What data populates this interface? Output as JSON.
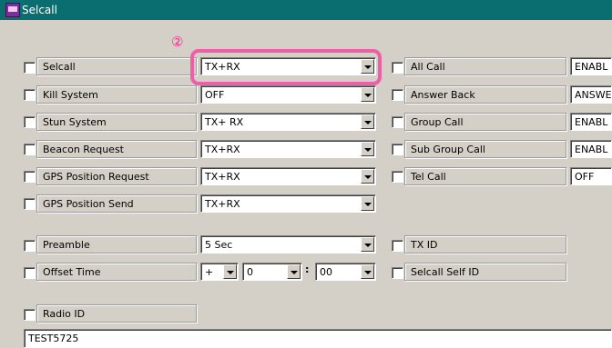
{
  "window": {
    "title": "Selcall",
    "annotation_marker": "②"
  },
  "rows": {
    "selcall": {
      "label": "Selcall",
      "value": "TX+RX"
    },
    "kill_system": {
      "label": "Kill System",
      "value": "OFF"
    },
    "stun_system": {
      "label": "Stun System",
      "value": "TX+ RX"
    },
    "beacon_request": {
      "label": "Beacon Request",
      "value": "TX+RX"
    },
    "gps_position_request": {
      "label": "GPS Position Request",
      "value": "TX+RX"
    },
    "gps_position_send": {
      "label": "GPS Position Send",
      "value": "TX+RX"
    },
    "all_call": {
      "label": "All Call",
      "value": "ENABL"
    },
    "answer_back": {
      "label": "Answer Back",
      "value": "ANSWE"
    },
    "group_call": {
      "label": "Group Call",
      "value": "ENABL"
    },
    "sub_group_call": {
      "label": "Sub Group Call",
      "value": "ENABL"
    },
    "tel_call": {
      "label": "Tel Call",
      "value": "OFF"
    },
    "preamble": {
      "label": "Preamble",
      "value": "5 Sec"
    },
    "offset_time": {
      "label": "Offset Time",
      "sign": "+",
      "minutes": "0",
      "separator": ":",
      "seconds": "00"
    },
    "tx_id": {
      "label": "TX ID"
    },
    "selcall_self_id": {
      "label": "Selcall Self ID"
    },
    "radio_id": {
      "label": "Radio ID",
      "value": "TEST5725"
    }
  }
}
